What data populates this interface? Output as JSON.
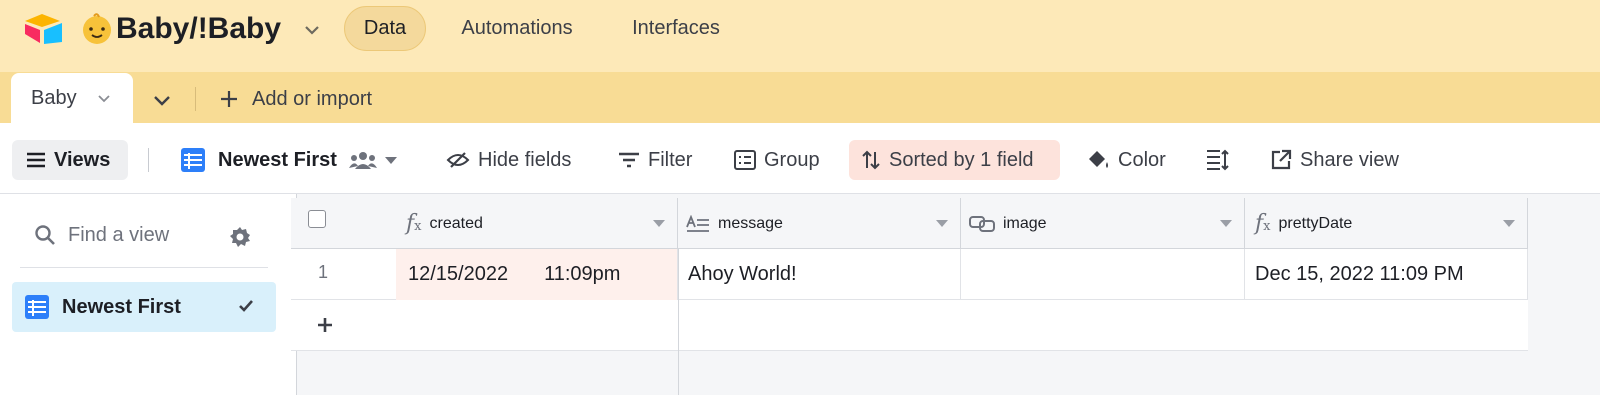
{
  "header": {
    "base_name": "Baby/!Baby",
    "tabs": [
      {
        "label": "Data",
        "active": true
      },
      {
        "label": "Automations",
        "active": false
      },
      {
        "label": "Interfaces",
        "active": false
      }
    ]
  },
  "table_bar": {
    "active_table": "Baby",
    "add_import_label": "Add or import"
  },
  "toolbar": {
    "views_label": "Views",
    "current_view": "Newest First",
    "hide_fields": "Hide fields",
    "filter": "Filter",
    "group": "Group",
    "sorted": "Sorted by 1 field",
    "color": "Color",
    "share_view": "Share view"
  },
  "sidebar": {
    "search_placeholder": "Find a view",
    "views": [
      {
        "label": "Newest First",
        "selected": true
      }
    ]
  },
  "grid": {
    "columns": [
      {
        "name": "created",
        "type": "formula"
      },
      {
        "name": "message",
        "type": "long-text"
      },
      {
        "name": "image",
        "type": "linked-record"
      },
      {
        "name": "prettyDate",
        "type": "formula"
      }
    ],
    "rows": [
      {
        "number": "1",
        "created_date": "12/15/2022",
        "created_time": "11:09pm",
        "message": "Ahoy World!",
        "image": "",
        "prettyDate": "Dec 15, 2022 11:09 PM"
      }
    ]
  },
  "colors": {
    "header_bg": "#fde9b8",
    "tabbar_bg": "#f8dc95",
    "sorted_bg": "#fde3dc",
    "selected_view_bg": "#d9f0fb",
    "grid_icon_blue": "#2d7ff9"
  }
}
